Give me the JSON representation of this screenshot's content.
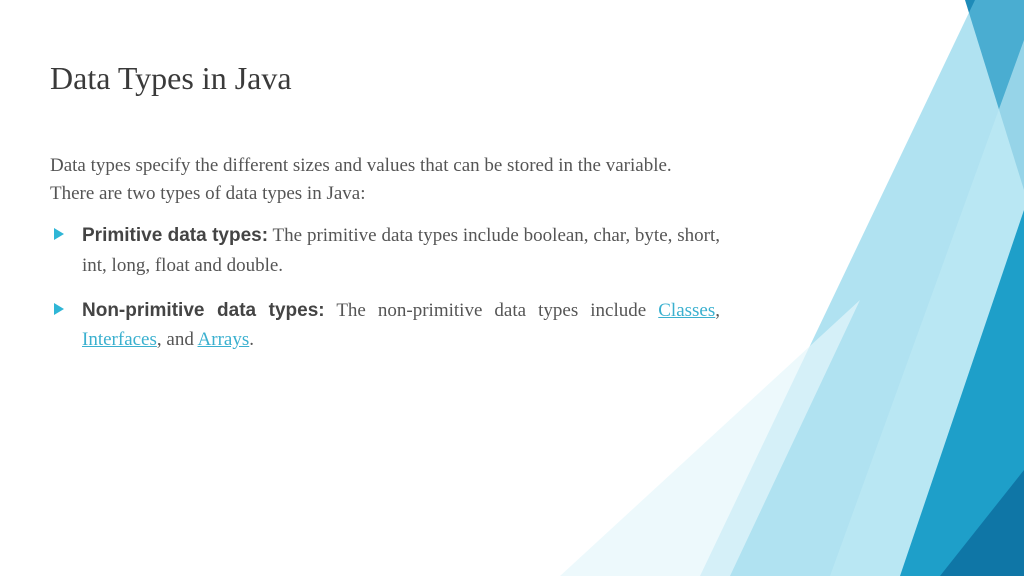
{
  "title": "Data Types in Java",
  "intro": "Data types specify the different sizes and values that can be stored in the variable. There are two types of data types in Java:",
  "bullets": [
    {
      "label": "Primitive data types:",
      "text": " The primitive data types include boolean, char, byte, short, int, long, float and double."
    },
    {
      "label": "Non-primitive data types:",
      "prefix": " The non-primitive data types include ",
      "links": [
        "Classes",
        "Interfaces",
        "Arrays"
      ],
      "sep1": ", ",
      "sep2": ", and ",
      "suffix": "."
    }
  ]
}
